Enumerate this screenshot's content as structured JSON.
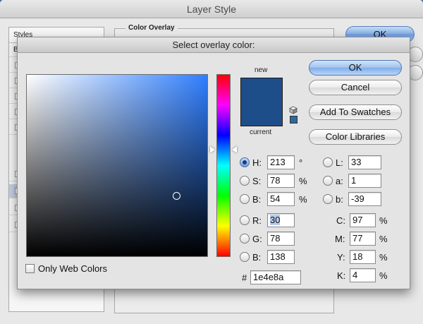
{
  "layer_style": {
    "title": "Layer Style",
    "styles_header": "Styles",
    "blend_prefix": "B",
    "group_label": "Color Overlay",
    "ok_label": "OK"
  },
  "dialog": {
    "title": "Select overlay color:",
    "new_label": "new",
    "current_label": "current",
    "new_color": "#1e4e8a",
    "current_color": "#1e4e8a",
    "buttons": {
      "ok": "OK",
      "cancel": "Cancel",
      "add_to_swatches": "Add To Swatches",
      "color_libraries": "Color Libraries"
    },
    "hsb": {
      "h": {
        "label": "H:",
        "value": "213",
        "unit": "°"
      },
      "s": {
        "label": "S:",
        "value": "78",
        "unit": "%"
      },
      "b": {
        "label": "B:",
        "value": "54",
        "unit": "%"
      }
    },
    "rgb": {
      "r": {
        "label": "R:",
        "value": "30"
      },
      "g": {
        "label": "G:",
        "value": "78"
      },
      "b": {
        "label": "B:",
        "value": "138"
      }
    },
    "lab": {
      "l": {
        "label": "L:",
        "value": "33"
      },
      "a": {
        "label": "a:",
        "value": "1"
      },
      "b": {
        "label": "b:",
        "value": "-39"
      }
    },
    "cmyk": {
      "c": {
        "label": "C:",
        "value": "97",
        "unit": "%"
      },
      "m": {
        "label": "M:",
        "value": "77",
        "unit": "%"
      },
      "y": {
        "label": "Y:",
        "value": "18",
        "unit": "%"
      },
      "k": {
        "label": "K:",
        "value": "4",
        "unit": "%"
      }
    },
    "hex": {
      "label": "#",
      "value": "1e4e8a"
    },
    "only_web_colors": "Only Web Colors"
  }
}
